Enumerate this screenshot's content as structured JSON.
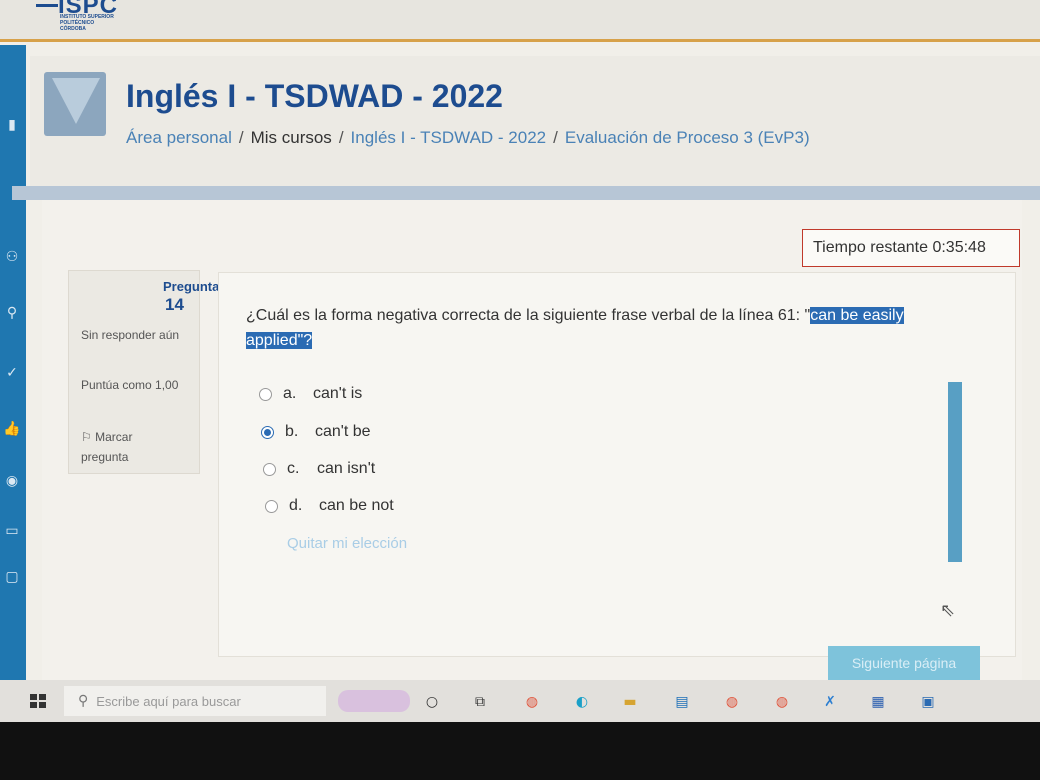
{
  "header": {
    "logo": {
      "brand": "ISPC",
      "subtitle": "INSTITUTO SUPERIOR POLITÉCNICO CÓRDOBA"
    },
    "title": "Inglés I - TSDWAD - 2022",
    "breadcrumb": [
      {
        "label": "Área personal"
      },
      {
        "label": "Mis cursos"
      },
      {
        "label": "Inglés I - TSDWAD - 2022"
      },
      {
        "label": "Evaluación de Proceso 3 (EvP3)"
      }
    ]
  },
  "quiz": {
    "timer": "Tiempo restante 0:35:48",
    "info": {
      "label": "Pregunta",
      "number": "14",
      "state": "Sin responder aún",
      "points": "Puntúa como 1,00",
      "flag": "Marcar pregunta"
    },
    "question": {
      "text": "¿Cuál es la forma negativa correcta de la siguiente frase verbal de la línea 61: \"",
      "highlight": "can be easily applied",
      "end": "\"?"
    },
    "answers": [
      {
        "letter": "a.",
        "text": "can't is",
        "selected": false
      },
      {
        "letter": "b.",
        "text": "can't be",
        "selected": true
      },
      {
        "letter": "c.",
        "text": "can isn't",
        "selected": false
      },
      {
        "letter": "d.",
        "text": "can be not",
        "selected": false
      }
    ],
    "clear_choice": "Quitar mi elección",
    "next_button": "Siguiente página"
  },
  "taskbar": {
    "search_placeholder": "Escribe aquí para buscar"
  },
  "colors": {
    "primary": "#1d4c8f",
    "link": "#4a82b6",
    "highlight": "#2b6bb3",
    "timer_border": "#c0392b",
    "next_button": "#7ec3db"
  }
}
